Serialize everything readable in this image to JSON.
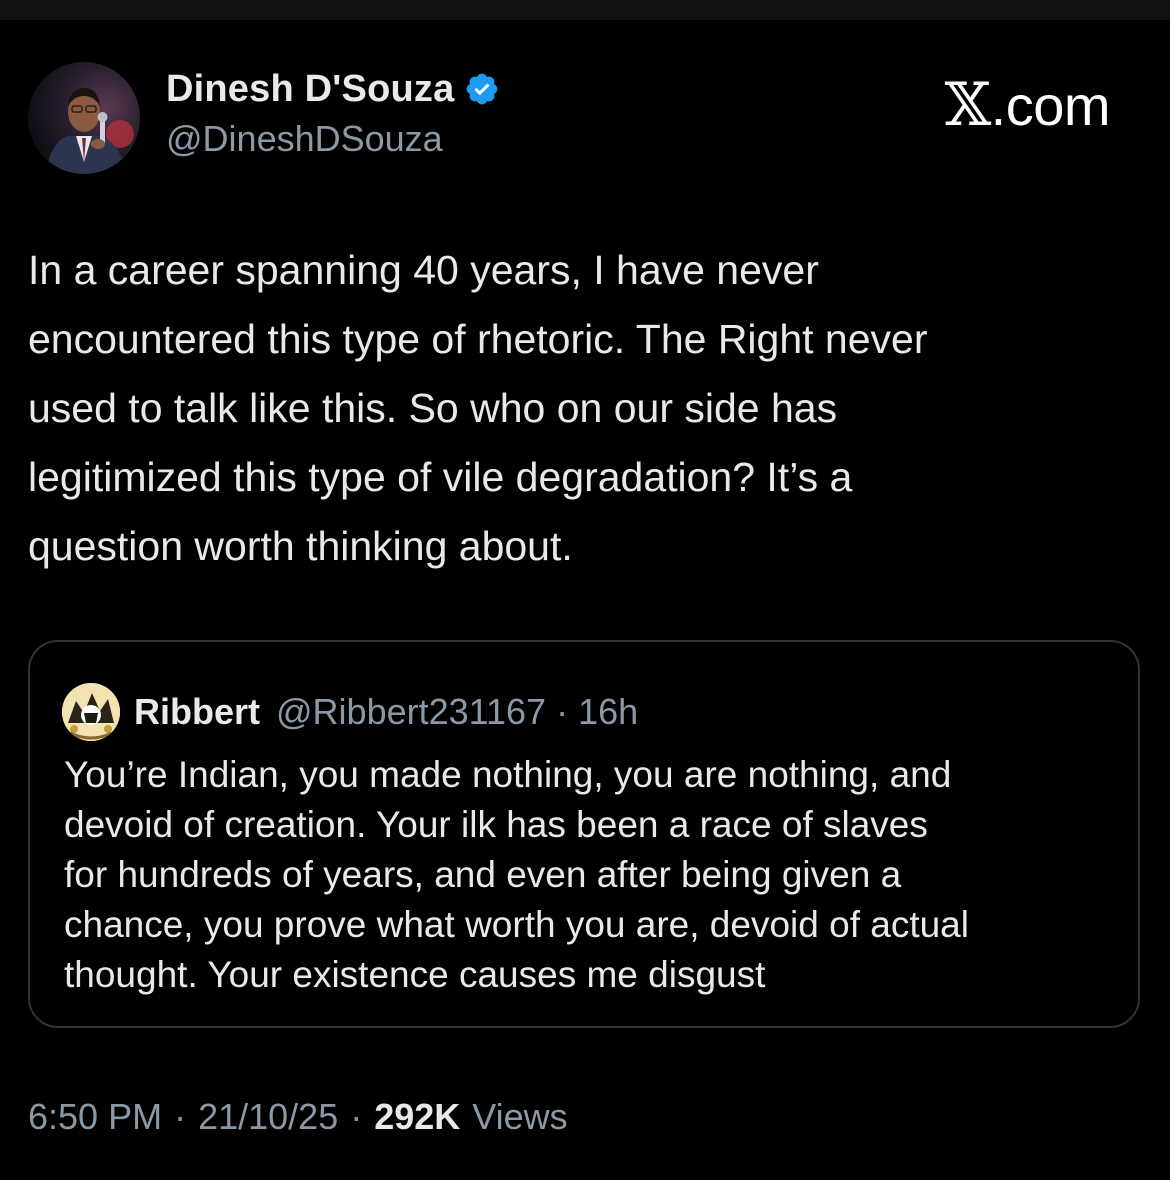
{
  "brand": {
    "text": ".com",
    "x_glyph": "𝕏"
  },
  "author": {
    "name": "Dinesh D'Souza",
    "handle": "@DineshDSouza",
    "verified_icon": "verified-badge-icon",
    "verified_color": "#1d9bf0"
  },
  "tweet": {
    "text": "In a career spanning 40 years, I have never\nencountered this type of rhetoric. The Right never\nused to talk like this. So who on our side has\nlegitimized this type of vile degradation? It’s a\nquestion worth thinking about."
  },
  "quoted": {
    "name": "Ribbert",
    "handle": "@Ribbert231167",
    "dot": "·",
    "time": "16h",
    "text": "You’re Indian, you made nothing, you are nothing, and\ndevoid of creation. Your ilk has been a race of slaves\nfor hundreds of years, and even after being given a\nchance, you prove what worth you are, devoid of actual\nthought. Your existence causes me disgust"
  },
  "meta": {
    "time": "6:50 PM",
    "sep1": "·",
    "date": "21/10/25",
    "sep2": "·",
    "views_count": "292K",
    "views_label": "Views"
  },
  "colors": {
    "background": "#000000",
    "text": "#e7e9ea",
    "secondary": "#8b98a5",
    "border": "#2f3336"
  }
}
